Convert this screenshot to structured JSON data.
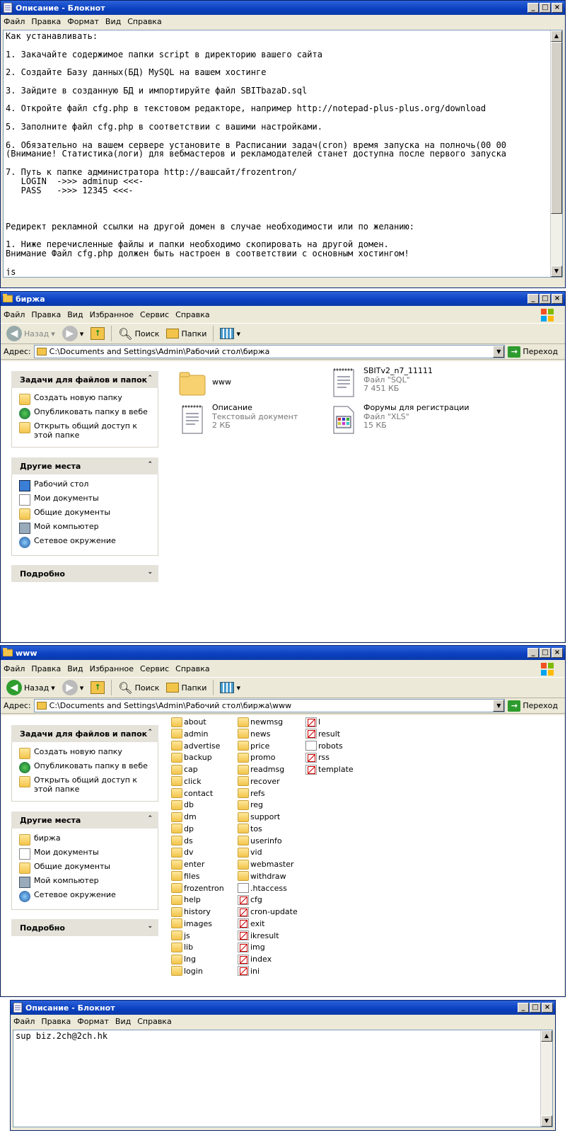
{
  "notepad1": {
    "title": "Описание - Блокнот",
    "menu": [
      "Файл",
      "Правка",
      "Формат",
      "Вид",
      "Справка"
    ],
    "lines": [
      "Как устанавливать:",
      "",
      "1. Закачайте содержимое папки script в директорию вашего сайта",
      "",
      "2. Создайте Базу данных(БД) MySQL на вашем хостинге",
      "",
      "3. Зайдите в созданную БД и импортируйте файл SBITbazaD.sql",
      "",
      "4. Откройте файл cfg.php в текстовом редакторе, например http://notepad-plus-plus.org/download",
      "",
      "5. Заполните файл cfg.php в соответствии с вашими настройками.",
      "",
      "6. Обязательно на вашем сервере установите в Расписании задач(cron) время запуска на полночь(00 00",
      "(Внимание! Статистика(логи) для вебмастеров и рекламодателей станет доступна после первого запуска",
      "",
      "7. Путь к папке администратора http://вашсайт/frozentron/",
      "   LOGIN  ->>> adminup <<<-",
      "   PASS   ->>> 12345 <<<-",
      "",
      "",
      "",
      "Редирект рекламной ссылки на другой домен в случае необходимости или по желанию:",
      "",
      "1. Ниже перечисленные файлы и папки необходимо скопировать на другой домен.",
      "Внимание Файл cfg.php должен быть настроен в соответствии с основным хостингом!",
      "",
      "js"
    ]
  },
  "explorer1": {
    "title": "биржа",
    "menu": [
      "Файл",
      "Правка",
      "Вид",
      "Избранное",
      "Сервис",
      "Справка"
    ],
    "toolbar": {
      "back": "Назад",
      "search": "Поиск",
      "folders": "Папки"
    },
    "address_label": "Адрес:",
    "address": "C:\\Documents and Settings\\Admin\\Рабочий стол\\биржа",
    "go": "Переход",
    "tasks_title": "Задачи для файлов и папок",
    "tasks": [
      "Создать новую папку",
      "Опубликовать папку в вебе",
      "Открыть общий доступ к этой папке"
    ],
    "places_title": "Другие места",
    "places": [
      "Рабочий стол",
      "Мои документы",
      "Общие документы",
      "Мой компьютер",
      "Сетевое окружение"
    ],
    "details_title": "Подробно",
    "files": [
      {
        "name": "www",
        "type": "",
        "size": ""
      },
      {
        "name": "SBITv2_n7_11111",
        "type": "Файл \"SQL\"",
        "size": "7 451 КБ"
      },
      {
        "name": "Описание",
        "type": "Текстовый документ",
        "size": "2 КБ"
      },
      {
        "name": "Форумы для регистрации",
        "type": "Файл \"XLS\"",
        "size": "15 КБ"
      }
    ]
  },
  "explorer2": {
    "title": "www",
    "menu": [
      "Файл",
      "Правка",
      "Вид",
      "Избранное",
      "Сервис",
      "Справка"
    ],
    "toolbar": {
      "back": "Назад",
      "search": "Поиск",
      "folders": "Папки"
    },
    "address_label": "Адрес:",
    "address": "C:\\Documents and Settings\\Admin\\Рабочий стол\\биржа\\www",
    "go": "Переход",
    "tasks_title": "Задачи для файлов и папок",
    "tasks": [
      "Создать новую папку",
      "Опубликовать папку в вебе",
      "Открыть общий доступ к этой папке"
    ],
    "places_title": "Другие места",
    "places": [
      "биржа",
      "Мои документы",
      "Общие документы",
      "Мой компьютер",
      "Сетевое окружение"
    ],
    "details_title": "Подробно",
    "col1": [
      "about",
      "admin",
      "advertise",
      "backup",
      "cap",
      "click",
      "contact",
      "db",
      "dm",
      "dp",
      "ds",
      "dv",
      "enter",
      "files",
      "frozentron",
      "help",
      "history",
      "images",
      "js",
      "lib",
      "lng",
      "login"
    ],
    "col2_folders": [
      "newmsg",
      "news",
      "price",
      "promo",
      "readmsg",
      "recover",
      "refs",
      "reg",
      "support",
      "tos",
      "userinfo",
      "vid",
      "webmaster",
      "withdraw"
    ],
    "col2_files": [
      ".htaccess",
      "cfg",
      "cron-update",
      "exit",
      "ikresult",
      "img",
      "index",
      "ini"
    ],
    "col3": [
      "l",
      "result",
      "robots",
      "rss",
      "template"
    ]
  },
  "notepad2": {
    "title": "Описание - Блокнот",
    "menu": [
      "Файл",
      "Правка",
      "Формат",
      "Вид",
      "Справка"
    ],
    "text": "sup biz.2ch@2ch.hk"
  }
}
